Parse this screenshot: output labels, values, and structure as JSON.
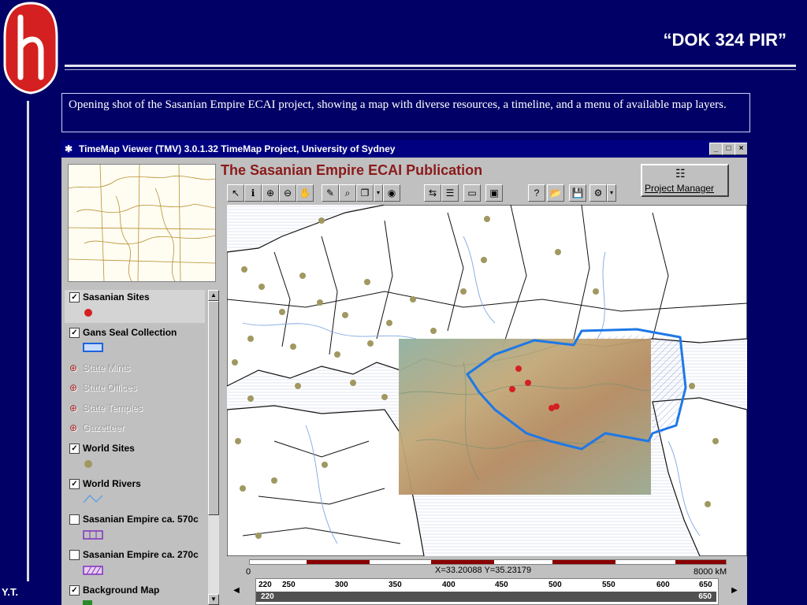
{
  "slide": {
    "title": "“DOK 324 PIR”",
    "caption": " Opening shot of the Sasanian Empire ECAI project, showing a map with diverse resources, a timeline, and a menu of available map layers.",
    "footer": "Y.T.",
    "colors": {
      "background": "#000066",
      "logo_red": "#d42020",
      "rule": "#e6e6f0"
    }
  },
  "window": {
    "title": "TimeMap Viewer (TMV) 3.0.1.32 TimeMap Project, University of Sydney",
    "controls": [
      "_",
      "□",
      "×"
    ],
    "publication_title": "The Sasanian Empire ECAI Publication",
    "project_manager_label": "Project Manager"
  },
  "toolbar": [
    {
      "icon": "select-arrow-icon",
      "glyph": "↖"
    },
    {
      "icon": "info-icon",
      "glyph": "ℹ"
    },
    {
      "icon": "zoom-in-icon",
      "glyph": "⊕"
    },
    {
      "icon": "zoom-out-icon",
      "glyph": "⊖"
    },
    {
      "icon": "pan-hand-icon",
      "glyph": "✋"
    },
    {
      "icon": "tag-icon",
      "glyph": "✎"
    },
    {
      "icon": "query-icon",
      "glyph": "⌕"
    },
    {
      "icon": "copy-icon",
      "glyph": "❐"
    },
    {
      "icon": "dropdown-icon",
      "glyph": "▾"
    },
    {
      "icon": "globe-icon",
      "glyph": "◉"
    },
    {
      "icon": "arrange-icon",
      "glyph": "⇆"
    },
    {
      "icon": "layers-icon",
      "glyph": "☰"
    },
    {
      "icon": "window-icon",
      "glyph": "▭"
    },
    {
      "icon": "image-icon",
      "glyph": "▣"
    },
    {
      "icon": "help-icon",
      "glyph": "?"
    },
    {
      "icon": "open-folder-icon",
      "glyph": "📂"
    },
    {
      "icon": "save-icon",
      "glyph": "💾"
    },
    {
      "icon": "settings-icon",
      "glyph": "⚙"
    },
    {
      "icon": "dropdown-icon",
      "glyph": "▾"
    }
  ],
  "layers": [
    {
      "label": "Sasanian Sites",
      "checked": true,
      "enabled": true,
      "legend": "red-dot"
    },
    {
      "label": "Gans Seal Collection",
      "checked": true,
      "enabled": true,
      "legend": "blue-outline"
    },
    {
      "label": "State Mints",
      "checked": false,
      "enabled": false
    },
    {
      "label": "State Offices",
      "checked": false,
      "enabled": false
    },
    {
      "label": "State Temples",
      "checked": false,
      "enabled": false
    },
    {
      "label": "Gazetteer",
      "checked": false,
      "enabled": false
    },
    {
      "label": "World Sites",
      "checked": true,
      "enabled": true,
      "legend": "olive-dot"
    },
    {
      "label": "World Rivers",
      "checked": true,
      "enabled": true,
      "legend": "river-line"
    },
    {
      "label": "Sasanian Empire ca. 570c",
      "checked": false,
      "enabled": true,
      "legend": "purple-box"
    },
    {
      "label": "Sasanian Empire ca. 270c",
      "checked": false,
      "enabled": true,
      "legend": "hatched-box"
    },
    {
      "label": "Background Map",
      "checked": true,
      "enabled": true,
      "legend": "green-box"
    }
  ],
  "timeline": {
    "start_label": "0",
    "end_label": "8000 kM",
    "coords": "X=33.20088  Y=35.23179",
    "ticks": [
      "220",
      "250",
      "300",
      "350",
      "400",
      "450",
      "500",
      "550",
      "600",
      "650"
    ],
    "range_start": "220",
    "range_end": "650"
  }
}
